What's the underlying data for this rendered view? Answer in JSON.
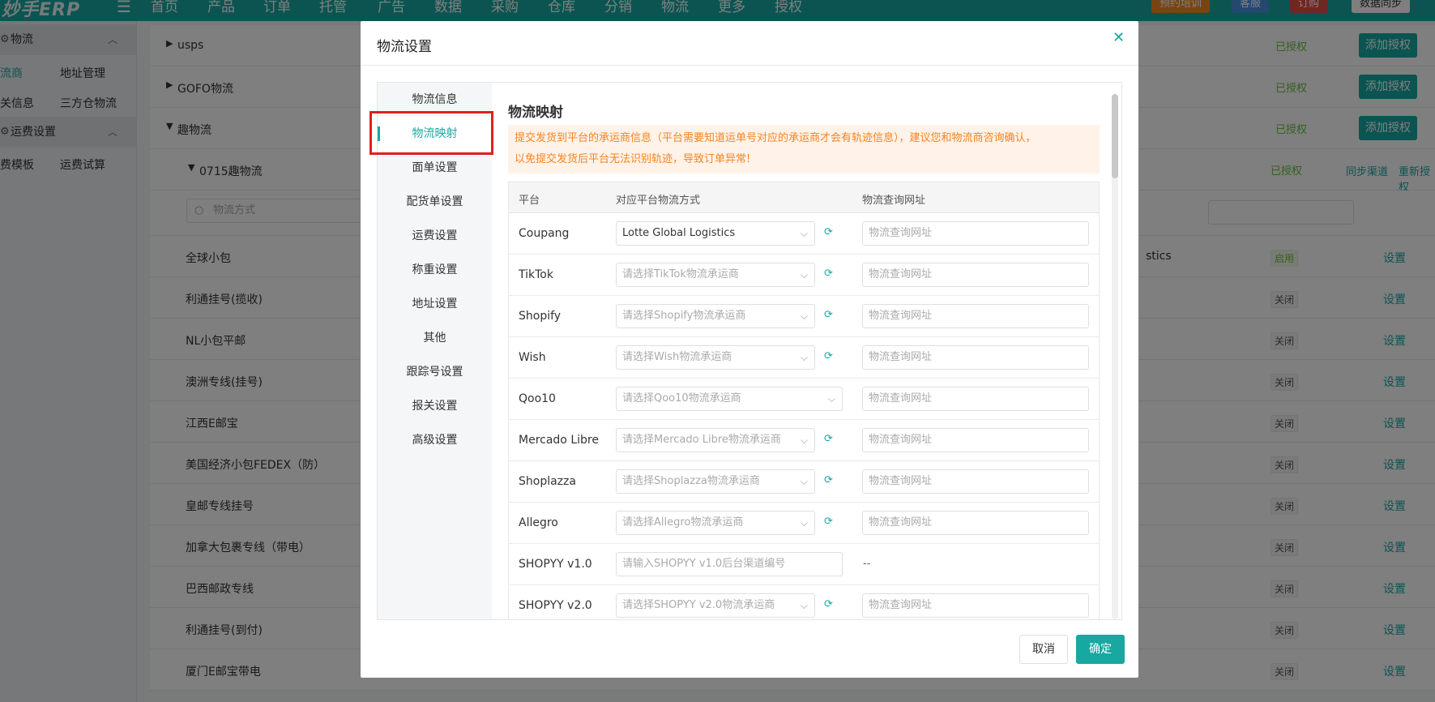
{
  "app": {
    "logo": "妙手ERP",
    "nav": [
      "首页",
      "产品",
      "订单",
      "托管",
      "广告",
      "数据",
      "采购",
      "仓库",
      "分销",
      "物流",
      "更多",
      "授权"
    ],
    "top_buttons": [
      "预约培训",
      "客服",
      "订购",
      "数据同步"
    ]
  },
  "sidebar": {
    "section_logistics": "物流",
    "items_a": [
      "流商",
      "地址管理",
      "关信息",
      "三方仓物流"
    ],
    "section_freight": "运费设置",
    "items_b": [
      "费模板",
      "运费试算"
    ]
  },
  "background": {
    "groups": [
      {
        "name": "usps",
        "auth": "已授权",
        "btn": "添加授权"
      },
      {
        "name": "GOFO物流",
        "auth": "已授权",
        "btn": "添加授权"
      },
      {
        "name": "趣物流",
        "auth": "已授权",
        "btn": "添加授权"
      }
    ],
    "sub_group": {
      "name": "0715趣物流",
      "auth": "已授权",
      "link1": "同步渠道",
      "link2": "重新授权"
    },
    "search_placeholder": "物流方式",
    "partial_text": "stics",
    "rows": [
      {
        "name": "全球小包",
        "status": "启用"
      },
      {
        "name": "利通挂号(揽收)",
        "status": "关闭"
      },
      {
        "name": "NL小包平邮",
        "status": "关闭"
      },
      {
        "name": "澳洲专线(挂号)",
        "status": "关闭"
      },
      {
        "name": "江西E邮宝",
        "status": "关闭"
      },
      {
        "name": "美国经济小包FEDEX（防）",
        "status": "关闭"
      },
      {
        "name": "皇邮专线挂号",
        "status": "关闭"
      },
      {
        "name": "加拿大包裹专线（带电）",
        "status": "关闭"
      },
      {
        "name": "巴西邮政专线",
        "status": "关闭"
      },
      {
        "name": "利通挂号(到付)",
        "status": "关闭"
      },
      {
        "name": "厦门E邮宝带电",
        "status": "关闭"
      }
    ],
    "set_label": "设置"
  },
  "modal": {
    "title": "物流设置",
    "tabs": [
      "物流信息",
      "物流映射",
      "面单设置",
      "配货单设置",
      "运费设置",
      "称重设置",
      "地址设置",
      "其他",
      "跟踪号设置",
      "报关设置",
      "高级设置"
    ],
    "active_tab": "物流映射",
    "pane_title": "物流映射",
    "notice_line1": "提交发货到平台的承运商信息（平台需要知道运单号对应的承运商才会有轨迹信息），建议您和物流商咨询确认，",
    "notice_line2": "以免提交发货后平台无法识别轨迹，导致订单异常!",
    "columns": [
      "平台",
      "对应平台物流方式",
      "物流查询网址"
    ],
    "url_placeholder": "物流查询网址",
    "rows": [
      {
        "platform": "Coupang",
        "value": "Lotte Global Logistics",
        "placeholder": "",
        "refresh": true,
        "url": true
      },
      {
        "platform": "TikTok",
        "value": "",
        "placeholder": "请选择TikTok物流承运商",
        "refresh": true,
        "url": true
      },
      {
        "platform": "Shopify",
        "value": "",
        "placeholder": "请选择Shopify物流承运商",
        "refresh": true,
        "url": true
      },
      {
        "platform": "Wish",
        "value": "",
        "placeholder": "请选择Wish物流承运商",
        "refresh": true,
        "url": true
      },
      {
        "platform": "Qoo10",
        "value": "",
        "placeholder": "请选择Qoo10物流承运商",
        "refresh": false,
        "url": true
      },
      {
        "platform": "Mercado Libre",
        "value": "",
        "placeholder": "请选择Mercado Libre物流承运商",
        "refresh": true,
        "url": true
      },
      {
        "platform": "Shoplazza",
        "value": "",
        "placeholder": "请选择Shoplazza物流承运商",
        "refresh": true,
        "url": true
      },
      {
        "platform": "Allegro",
        "value": "",
        "placeholder": "请选择Allegro物流承运商",
        "refresh": true,
        "url": true
      },
      {
        "platform": "SHOPYY v1.0",
        "value": "",
        "placeholder": "请输入SHOPYY v1.0后台渠道编号",
        "refresh": false,
        "url": false,
        "dash": "--"
      },
      {
        "platform": "SHOPYY v2.0",
        "value": "",
        "placeholder": "请选择SHOPYY v2.0物流承运商",
        "refresh": true,
        "url": true
      }
    ],
    "cancel": "取消",
    "confirm": "确定"
  },
  "colors": {
    "accent": "#17a8a2",
    "highlight": "#e02020",
    "notice_text": "#f7841f"
  }
}
